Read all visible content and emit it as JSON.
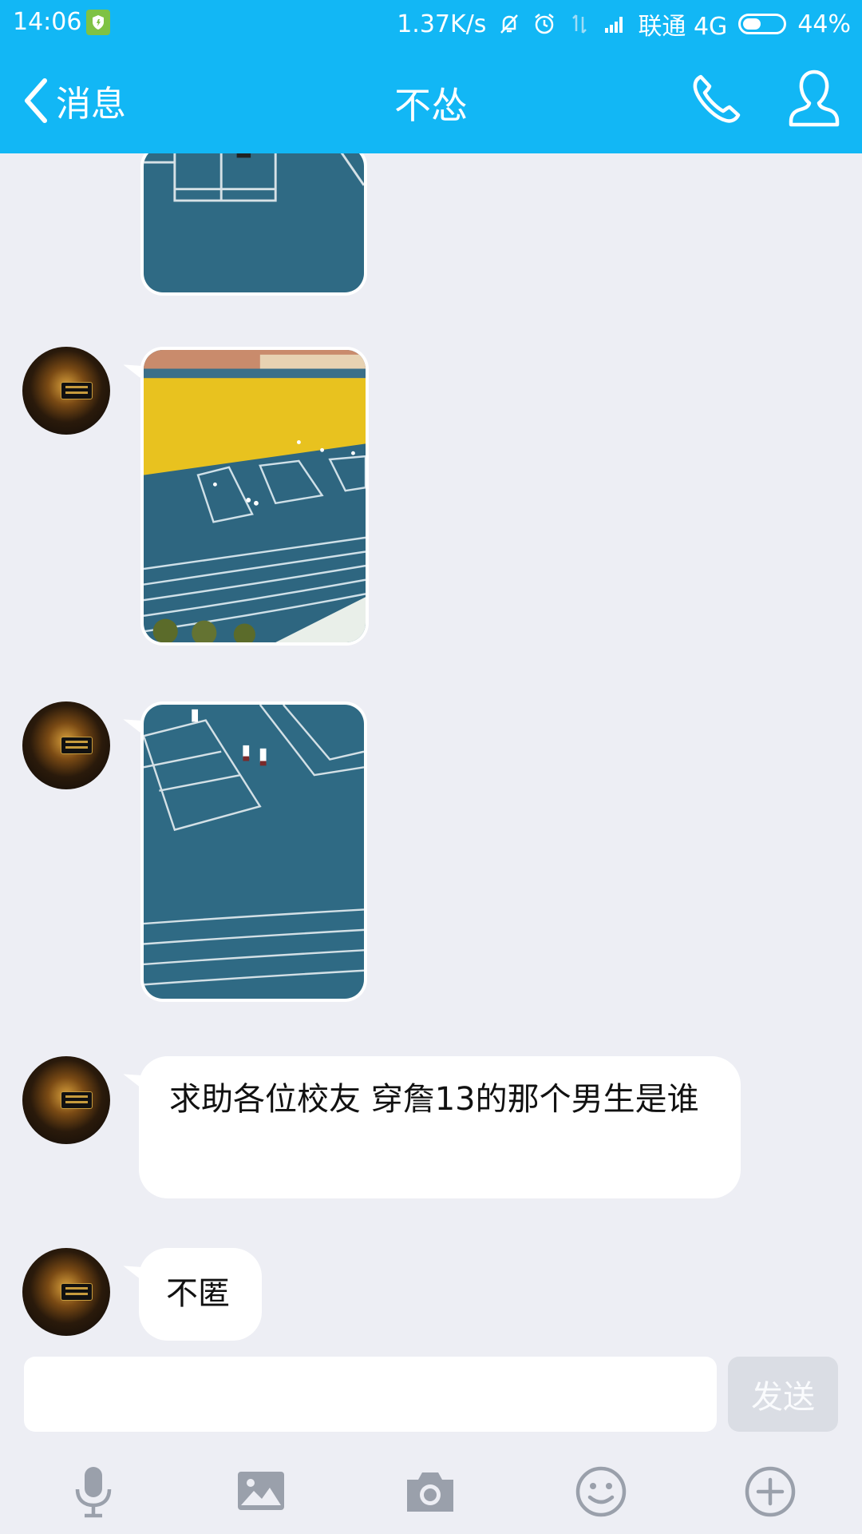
{
  "status_bar": {
    "time": "14:06",
    "net_speed": "1.37K/s",
    "carrier": "联通 4G",
    "battery": "44%",
    "battery_level": 0.44
  },
  "header": {
    "back_label": "消息",
    "title": "不怂"
  },
  "messages": [
    {
      "type": "image",
      "content": "partial-photo-court"
    },
    {
      "type": "image",
      "content": "photo-field-track"
    },
    {
      "type": "image",
      "content": "photo-court-players"
    },
    {
      "type": "text",
      "text": "求助各位校友 穿詹13的那个男生是谁"
    },
    {
      "type": "text",
      "text": "不匿"
    }
  ],
  "input": {
    "value": "",
    "placeholder": "",
    "send_label": "发送"
  },
  "toolbar": {
    "icons": [
      "microphone-icon",
      "image-icon",
      "camera-icon",
      "emoji-icon",
      "plus-icon"
    ]
  },
  "colors": {
    "header_bg": "#12b7f5",
    "chat_bg": "#edeef4",
    "court_blue": "#2e6680",
    "field_yellow": "#e8c21f"
  }
}
